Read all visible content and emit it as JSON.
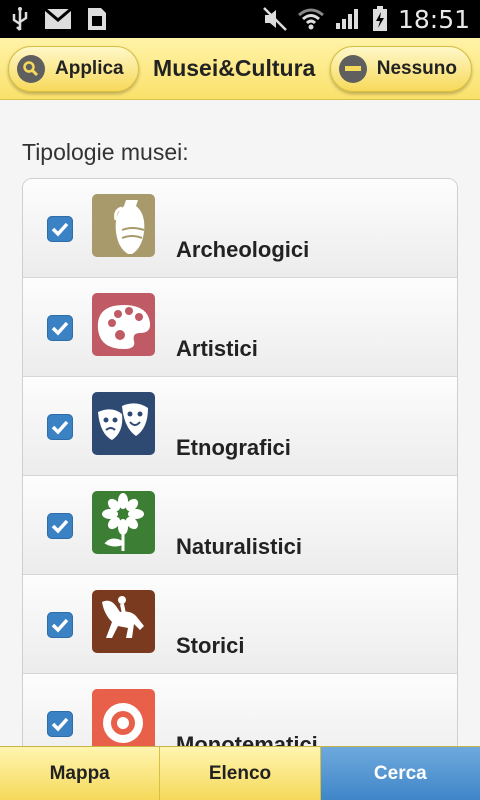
{
  "statusbar": {
    "time": "18:51"
  },
  "header": {
    "apply_label": "Applica",
    "title": "Musei&Cultura",
    "none_label": "Nessuno"
  },
  "section_label": "Tipologie musei:",
  "items": [
    {
      "label": "Archeologici",
      "checked": true,
      "color": "#a89a6a",
      "icon": "amphora-icon"
    },
    {
      "label": "Artistici",
      "checked": true,
      "color": "#c05a64",
      "icon": "palette-icon"
    },
    {
      "label": "Etnografici",
      "checked": true,
      "color": "#2e4a73",
      "icon": "theater-masks-icon"
    },
    {
      "label": "Naturalistici",
      "checked": true,
      "color": "#3c7f34",
      "icon": "flower-icon"
    },
    {
      "label": "Storici",
      "checked": true,
      "color": "#7a3a1f",
      "icon": "horse-rider-icon"
    },
    {
      "label": "Monotematici",
      "checked": true,
      "color": "#e8604a",
      "icon": "target-icon"
    }
  ],
  "tabs": [
    {
      "label": "Mappa",
      "active": false
    },
    {
      "label": "Elenco",
      "active": false
    },
    {
      "label": "Cerca",
      "active": true
    }
  ]
}
